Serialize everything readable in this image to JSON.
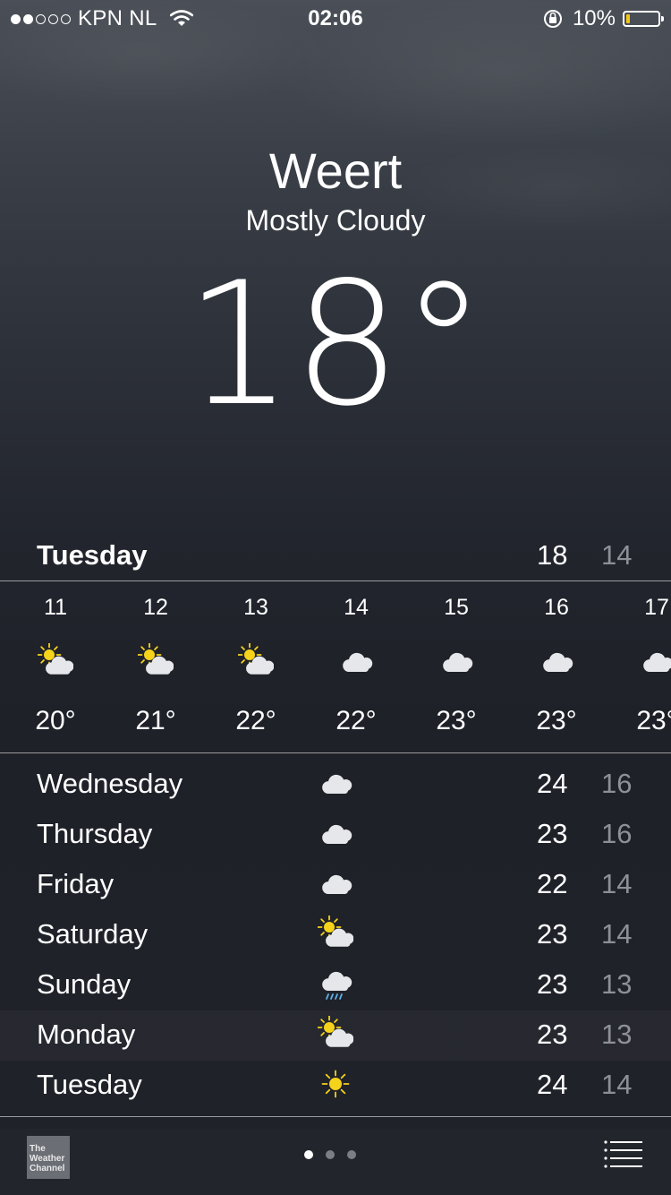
{
  "status": {
    "carrier": "KPN NL",
    "time": "02:06",
    "battery": "10%",
    "signal_bars": 2
  },
  "header": {
    "city": "Weert",
    "condition": "Mostly Cloudy",
    "temperature": "18°"
  },
  "today": {
    "day": "Tuesday",
    "high": "18",
    "low": "14"
  },
  "hourly": [
    {
      "hour": "11",
      "icon": "partly-sunny-icon",
      "temp": "20°"
    },
    {
      "hour": "12",
      "icon": "partly-sunny-icon",
      "temp": "21°"
    },
    {
      "hour": "13",
      "icon": "partly-sunny-icon",
      "temp": "22°"
    },
    {
      "hour": "14",
      "icon": "cloud-icon",
      "temp": "22°"
    },
    {
      "hour": "15",
      "icon": "cloud-icon",
      "temp": "23°"
    },
    {
      "hour": "16",
      "icon": "cloud-icon",
      "temp": "23°"
    },
    {
      "hour": "17",
      "icon": "cloud-icon",
      "temp": "23°"
    }
  ],
  "daily": [
    {
      "day": "Wednesday",
      "icon": "cloud-icon",
      "high": "24",
      "low": "16"
    },
    {
      "day": "Thursday",
      "icon": "cloud-icon",
      "high": "23",
      "low": "16"
    },
    {
      "day": "Friday",
      "icon": "cloud-icon",
      "high": "22",
      "low": "14"
    },
    {
      "day": "Saturday",
      "icon": "partly-sunny-icon",
      "high": "23",
      "low": "14"
    },
    {
      "day": "Sunday",
      "icon": "rain-icon",
      "high": "23",
      "low": "13"
    },
    {
      "day": "Monday",
      "icon": "partly-sunny-icon",
      "high": "23",
      "low": "13"
    },
    {
      "day": "Tuesday",
      "icon": "sun-icon",
      "high": "24",
      "low": "14"
    }
  ],
  "footer": {
    "logo_text": "The Weather Channel",
    "pages": 3,
    "active_page": 0
  },
  "colors": {
    "sun": "#f5d31a",
    "cloud": "#e6e7ea",
    "rain": "#5fb0e8",
    "low_temp": "#8e9097",
    "battery_fill": "#f5c518"
  }
}
